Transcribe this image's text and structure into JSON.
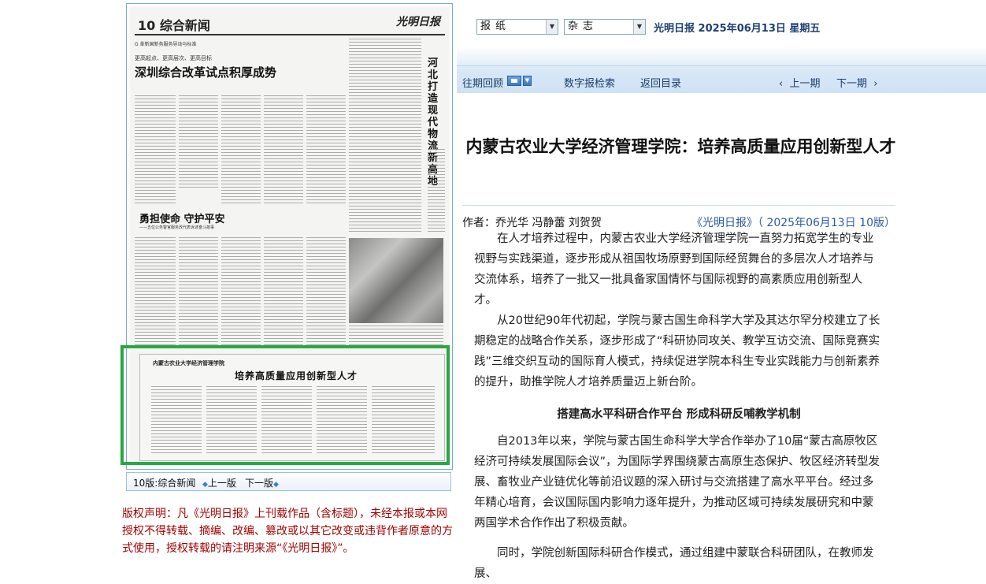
{
  "header": {
    "select_paper": "报纸",
    "select_magazine": "杂志",
    "date_text": "光明日报 2025年06月13日 星期五"
  },
  "nav": {
    "past_review": "往期回顾",
    "digital_search": "数字报检索",
    "back_to_index": "返回目录",
    "prev_issue": "上一期",
    "next_issue": "下一期",
    "chevron_left": "‹",
    "chevron_right": "›"
  },
  "newspaper": {
    "page_name": "10 综合新闻",
    "logo": "光明日报",
    "section": "G 革新国新务服务导动与标准",
    "kicker": "更高起点、更高层次、更高目标",
    "title_main": "深圳综合改革试点积厚成势",
    "side_headline": "河北打造现代物流新高地",
    "title_second": "勇担使命 守护平安",
    "subtitle_second": "——五位公务警官服务改代表诉述奋斗故事",
    "highlight_kicker": "内蒙古农业大学经济管理学院",
    "highlight_title": "培养高质量应用创新型人才"
  },
  "page_nav": {
    "current": "10版:综合新闻",
    "prev_page": "上一版",
    "next_page": "下一版"
  },
  "copyright": "版权声明：凡《光明日报》上刊载作品（含标题），未经本报或本网授权不得转载、摘编、改编、篡改或以其它改变或违背作者原意的方式使用，授权转载的请注明来源“《光明日报》”。",
  "article": {
    "title": "内蒙古农业大学经济管理学院：培养高质量应用创新型人才",
    "author": "作者：乔光华 冯静蕾 刘贺贺",
    "source": "《光明日报》（ 2025年06月13日 10版）",
    "paragraphs": [
      "在人才培养过程中，内蒙古农业大学经济管理学院一直努力拓宽学生的专业视野与实践渠道，逐步形成从祖国牧场原野到国际经贸舞台的多层次人才培养与交流体系，培养了一批又一批具备家国情怀与国际视野的高素质应用创新型人才。",
      "从20世纪90年代初起，学院与蒙古国生命科学大学及其达尔罕分校建立了长期稳定的战略合作关系，逐步形成了“科研协同攻关、教学互访交流、国际竞赛实践”三维交织互动的国际育人模式，持续促进学院本科生专业实践能力与创新素养的提升，助推学院人才培养质量迈上新台阶。",
      "自2013年以来，学院与蒙古国生命科学大学合作举办了10届“蒙古高原牧区经济可持续发展国际会议”，为国际学界围绕蒙古高原生态保护、牧区经济转型发展、畜牧业产业链优化等前沿议题的深入研讨与交流搭建了高水平平台。经过多年精心培育，会议国际国内影响力逐年提升，为推动区域可持续发展研究和中蒙两国学术合作作出了积极贡献。",
      "同时，学院创新国际科研合作模式，通过组建中蒙联合科研团队，在教师发展、"
    ],
    "subheading": "搭建高水平科研合作平台 形成科研反哺教学机制"
  }
}
